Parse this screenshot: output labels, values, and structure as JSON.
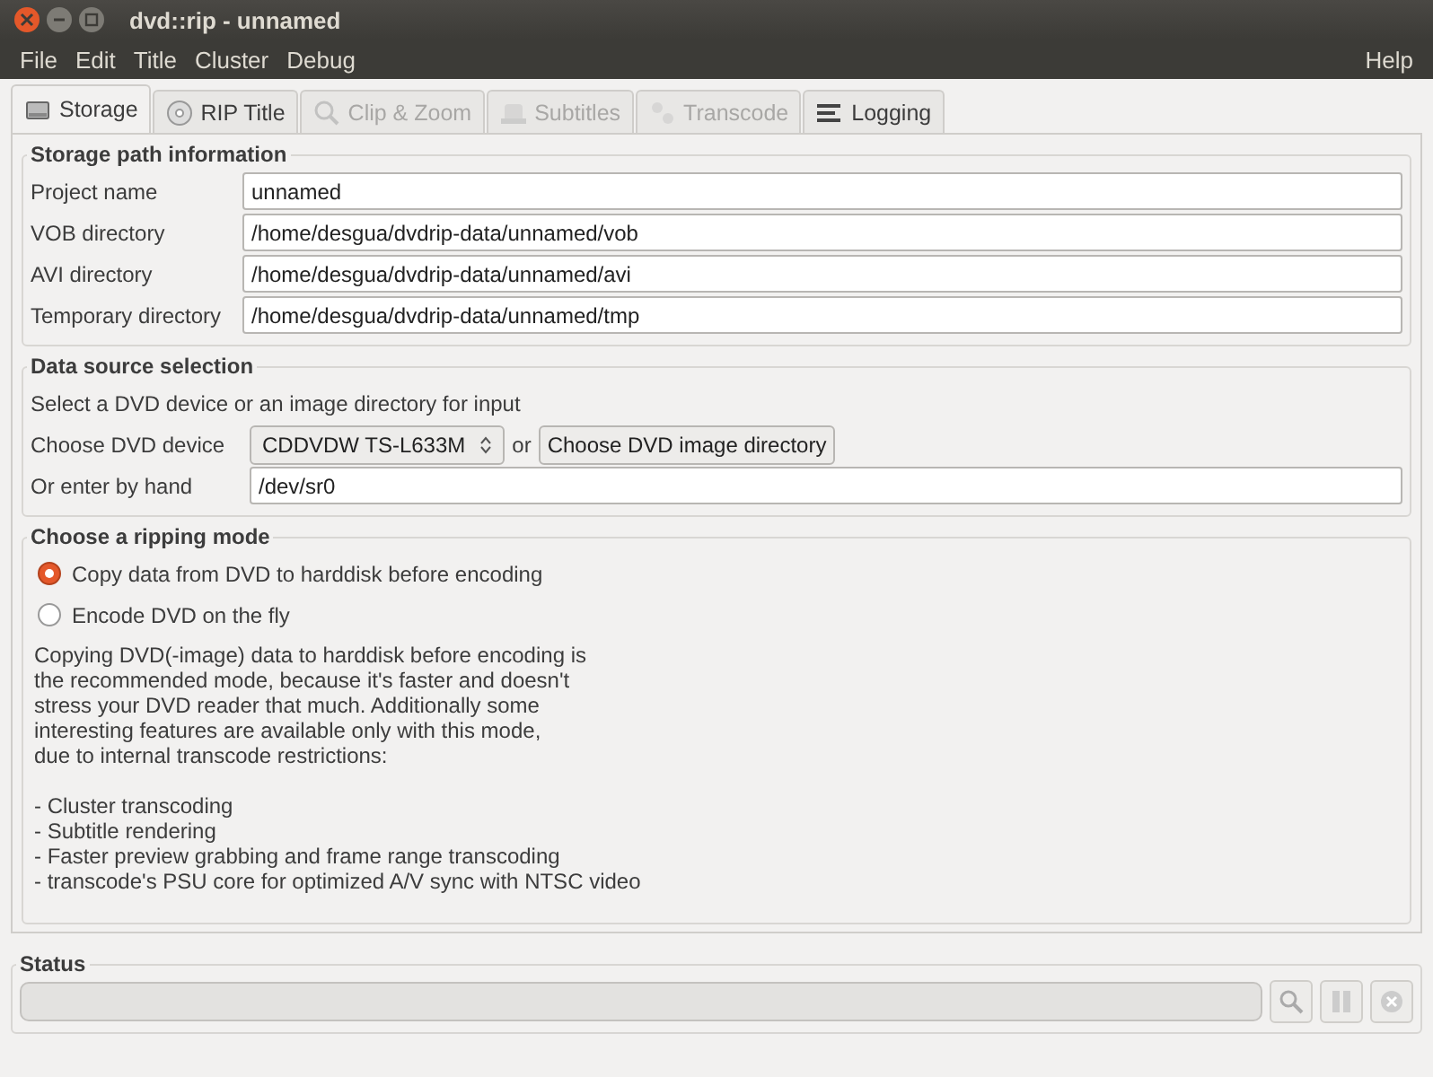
{
  "window": {
    "title": "dvd::rip - unnamed"
  },
  "menu": [
    "File",
    "Edit",
    "Title",
    "Cluster",
    "Debug"
  ],
  "help_menu": "Help",
  "tabs": [
    {
      "label": "Storage",
      "kind": "disk",
      "selected": true,
      "disabled": false
    },
    {
      "label": "RIP Title",
      "kind": "cd",
      "selected": false,
      "disabled": false
    },
    {
      "label": "Clip & Zoom",
      "kind": "zoom",
      "selected": false,
      "disabled": true
    },
    {
      "label": "Subtitles",
      "kind": "sub",
      "selected": false,
      "disabled": true
    },
    {
      "label": "Transcode",
      "kind": "gears",
      "selected": false,
      "disabled": true
    },
    {
      "label": "Logging",
      "kind": "log",
      "selected": false,
      "disabled": false
    }
  ],
  "storage": {
    "title": "Storage path information",
    "fields": [
      {
        "label": "Project name",
        "value": "unnamed"
      },
      {
        "label": "VOB directory",
        "value": "/home/desgua/dvdrip-data/unnamed/vob"
      },
      {
        "label": "AVI directory",
        "value": "/home/desgua/dvdrip-data/unnamed/avi"
      },
      {
        "label": "Temporary directory",
        "value": "/home/desgua/dvdrip-data/unnamed/tmp"
      }
    ]
  },
  "source": {
    "title": "Data source selection",
    "hint": "Select a DVD device or an image directory for input",
    "device_label": "Choose DVD device",
    "device": "CDDVDW TS-L633M",
    "or": "or",
    "image_button": "Choose DVD image directory",
    "hand_label": "Or enter by hand",
    "hand_value": "/dev/sr0"
  },
  "mode": {
    "title": "Choose a ripping mode",
    "options": [
      {
        "label": "Copy data from DVD to harddisk before encoding",
        "selected": true
      },
      {
        "label": "Encode DVD on the fly",
        "selected": false
      }
    ],
    "description": [
      "Copying DVD(-image) data to harddisk before encoding is",
      "the recommended mode, because it's faster and doesn't",
      "stress your DVD reader that much. Additionally some",
      "interesting features are available only with this mode,",
      "due to internal transcode restrictions:"
    ],
    "features": [
      "- Cluster transcoding",
      "- Subtitle rendering",
      "- Faster preview grabbing and frame range transcoding",
      "- transcode's PSU core for optimized A/V sync with NTSC video"
    ]
  },
  "status": {
    "title": "Status",
    "level": 0
  }
}
